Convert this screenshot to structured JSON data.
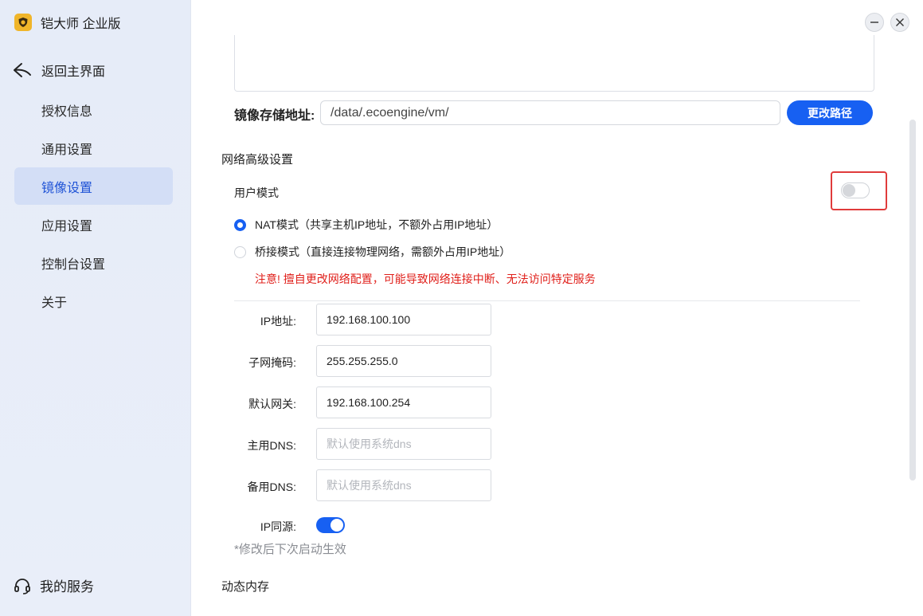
{
  "app": {
    "title": "铠大师 企业版"
  },
  "sidebar": {
    "back_label": "返回主界面",
    "items": [
      {
        "label": "授权信息",
        "active": false
      },
      {
        "label": "通用设置",
        "active": false
      },
      {
        "label": "镜像设置",
        "active": true
      },
      {
        "label": "应用设置",
        "active": false
      },
      {
        "label": "控制台设置",
        "active": false
      },
      {
        "label": "关于",
        "active": false
      }
    ],
    "service_label": "我的服务"
  },
  "storage": {
    "label": "镜像存储地址:",
    "path": "/data/.ecoengine/vm/",
    "change_button": "更改路径"
  },
  "network": {
    "title": "网络高级设置",
    "user_mode_label": "用户模式",
    "user_mode_enabled": false,
    "options": [
      {
        "label": "NAT模式（共享主机IP地址，不额外占用IP地址）",
        "selected": true
      },
      {
        "label": "桥接模式（直接连接物理网络，需额外占用IP地址）",
        "selected": false
      }
    ],
    "warning": "注意! 擅自更改网络配置，可能导致网络连接中断、无法访问特定服务",
    "fields": [
      {
        "label": "IP地址:",
        "value": "192.168.100.100",
        "placeholder": ""
      },
      {
        "label": "子网掩码:",
        "value": "255.255.255.0",
        "placeholder": ""
      },
      {
        "label": "默认网关:",
        "value": "192.168.100.254",
        "placeholder": ""
      },
      {
        "label": "主用DNS:",
        "value": "",
        "placeholder": "默认使用系统dns"
      },
      {
        "label": "备用DNS:",
        "value": "",
        "placeholder": "默认使用系统dns"
      }
    ],
    "ip_same_source_label": "IP同源:",
    "ip_same_source_enabled": true,
    "note": "*修改后下次启动生效"
  },
  "memory": {
    "title": "动态内存"
  },
  "colors": {
    "accent": "#1760f2",
    "warning": "#e0201b",
    "sidebar_active_bg": "#d3def6",
    "highlight": "#e03b3b"
  }
}
